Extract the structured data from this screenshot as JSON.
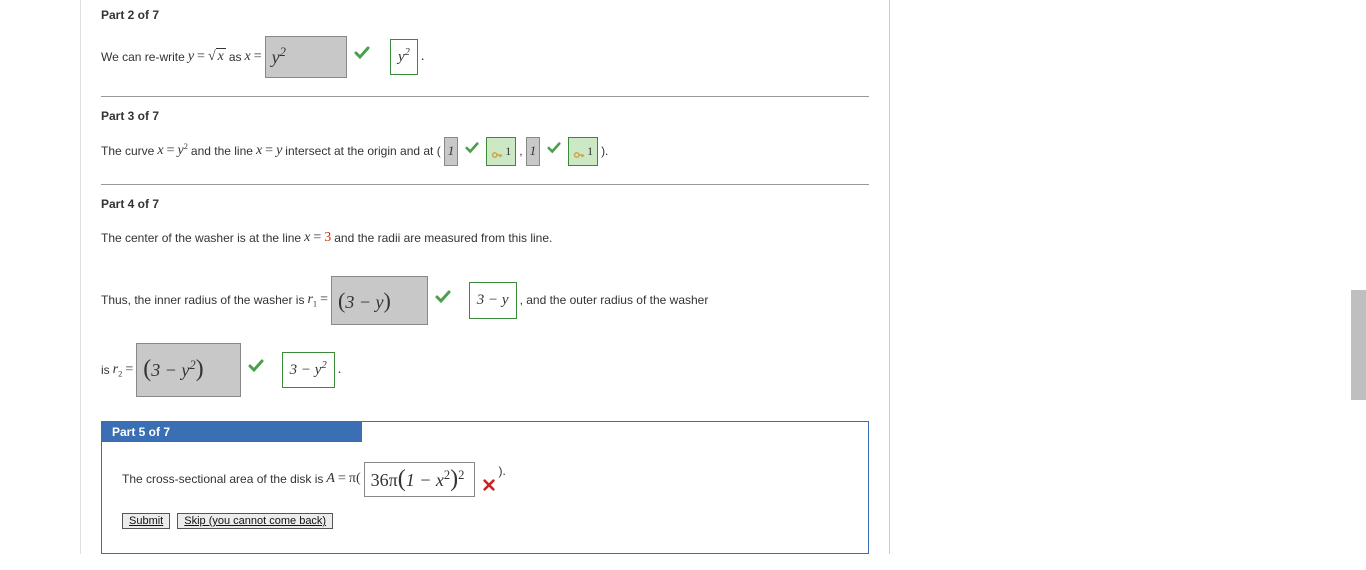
{
  "part2": {
    "header": "Part 2 of 7",
    "text1": "We can re-write ",
    "eq1_y": "y",
    "eq1_eq": " = ",
    "eq1_sqrt_arg": "x",
    "text2": " as ",
    "eq2_x": "x",
    "eq2_eq": " = ",
    "answer": "y",
    "answer_exp": "2",
    "correct": "y",
    "correct_exp": "2",
    "dot": "."
  },
  "part3": {
    "header": "Part 3 of 7",
    "text1": "The curve ",
    "eq1a": "x",
    "eq1b": " = ",
    "eq1c": "y",
    "eq1d": "2",
    "text2": " and the line ",
    "eq2a": "x",
    "eq2b": " = ",
    "eq2c": "y",
    "text3": " intersect at the origin and at ( ",
    "ans1": "1",
    "key1": "1",
    "comma": " , ",
    "ans2": "1",
    "key2": "1",
    "close": " )."
  },
  "part4": {
    "header": "Part 4 of 7",
    "line1a": "The center of the washer is at the line ",
    "line1_x": "x",
    "line1_eq": " = ",
    "line1_val": "3",
    "line1b": " and the radii are measured from this line.",
    "line2a": "Thus, the inner radius of the washer is ",
    "r1": "r",
    "r1sub": "1",
    "eq": " = ",
    "ans_r1_l": "(",
    "ans_r1_body": "3 − y",
    "ans_r1_r": ")",
    "corr_r1": "3 − y",
    "line2b": ", and the outer radius of the washer",
    "line3a": "is ",
    "r2": "r",
    "r2sub": "2",
    "ans_r2_l": "(",
    "ans_r2_a": "3 − y",
    "ans_r2_exp": "2",
    "ans_r2_r": ")",
    "corr_r2_a": "3 − y",
    "corr_r2_exp": "2",
    "dot": "."
  },
  "part5": {
    "header": "Part 5 of 7",
    "text1": "The cross-sectional area of the disk is ",
    "A": "A",
    "eq": " = ",
    "pi": "π( ",
    "ans_a": "36π",
    "ans_l": "(",
    "ans_b": "1 − x",
    "ans_exp1": "2",
    "ans_r": ")",
    "ans_exp2": "2",
    "close": " ).",
    "btn_submit": "Submit",
    "btn_skip": "Skip (you cannot come back)"
  }
}
